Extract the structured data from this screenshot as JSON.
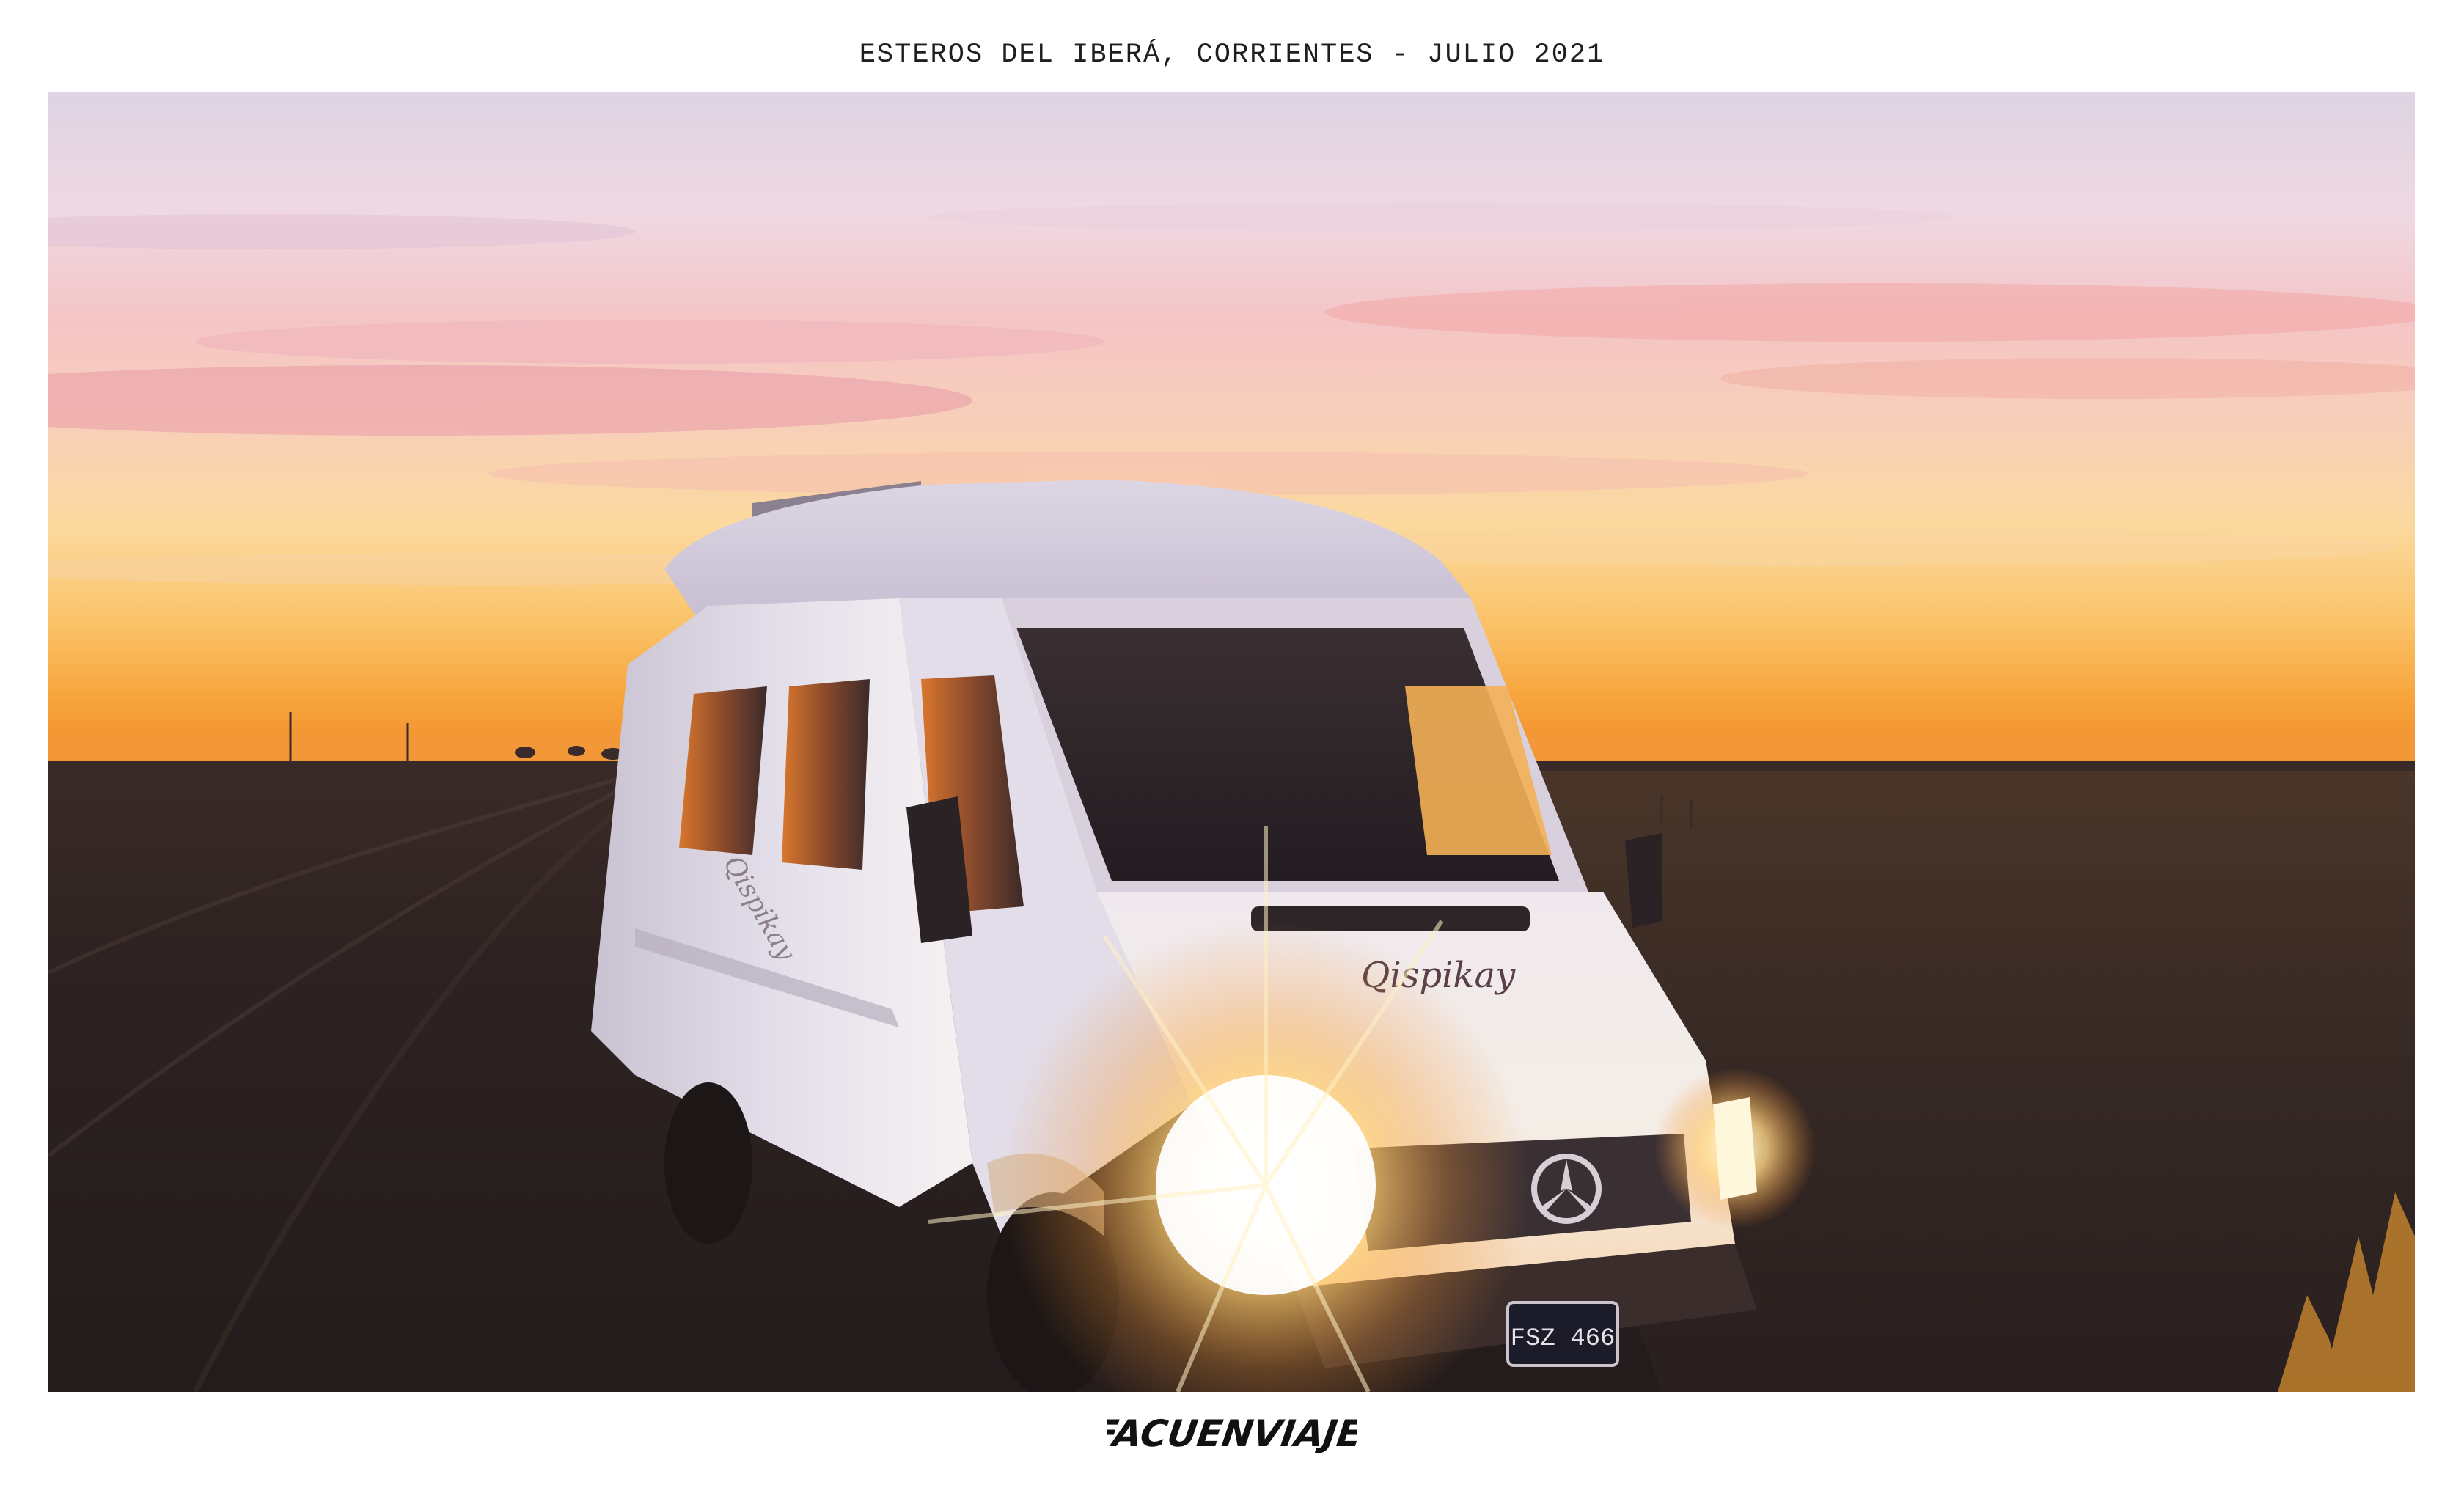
{
  "caption": "ESTEROS DEL IBERÁ, CORRIENTES - JULIO 2021",
  "photo": {
    "van_logo": "Qispikay",
    "plate": "FSZ 466"
  },
  "signature": "FACUENVIAJE",
  "colors": {
    "sky_top": "#e9dbe6",
    "sky_pink": "#f0a9a4",
    "horizon": "#f7a12a",
    "ground": "#2b2020",
    "van_body": "#e9e6ee",
    "headlight": "#fff6d8",
    "caption_text": "#1e1e1e"
  }
}
